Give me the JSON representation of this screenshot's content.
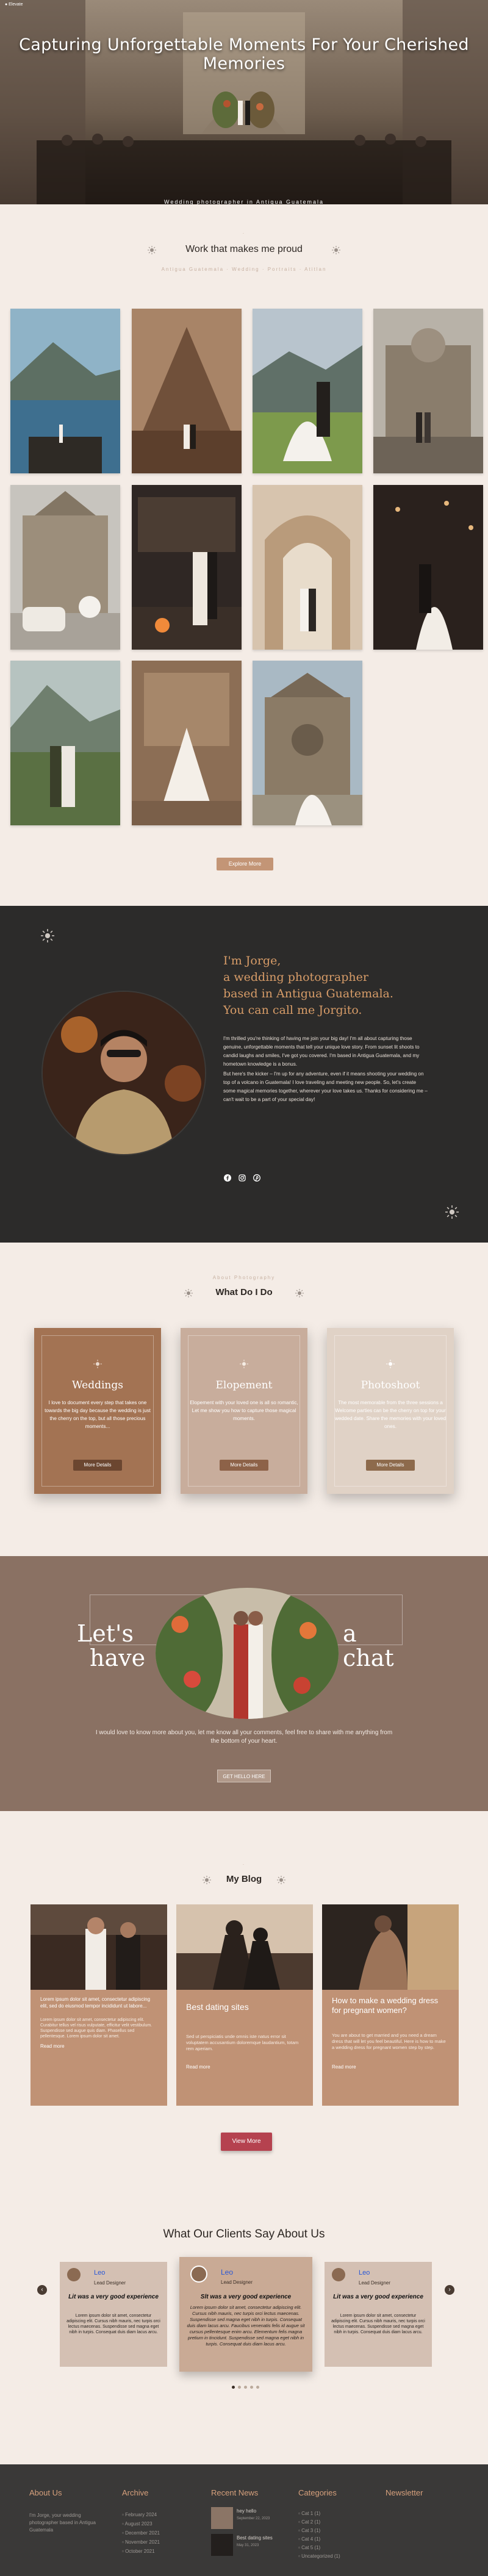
{
  "header": {
    "brand": "● Elevate"
  },
  "hero": {
    "title": "Capturing Unforgettable Moments For Your Cherished Memories",
    "subtitle": "Wedding photographer  in  Antigua Guatemala"
  },
  "work": {
    "title": "Work that makes me proud",
    "subtitle": "Antigua Guatemala · Wedding · Portraits · Atitlan",
    "explore_button": "Explore More"
  },
  "about": {
    "title_lines": [
      "I'm Jorge,",
      "a wedding photographer",
      "based in Antigua Guatemala.",
      "You can call me Jorgito."
    ],
    "paragraphs": [
      "I'm thrilled you're thinking of having me join your big day! I'm all about capturing those genuine, unforgettable moments that tell your unique love story. From sunset lit shoots to candid laughs and smiles, I've got you covered. I'm based in Antigua Guatemala, and my hometown knowledge is a bonus.",
      "But here's the kicker – I'm up for any adventure, even if it means shooting your wedding on top of a volcano in Guatemala! I love traveling and meeting new people. So, let's create some magical memories together, wherever your love takes us. Thanks for considering me – can't wait to be a part of your special day!"
    ],
    "social_icons": [
      "facebook-icon",
      "instagram-icon",
      "pinterest-icon"
    ]
  },
  "services": {
    "kicker": "About Photography",
    "title": "What Do I Do",
    "cards": [
      {
        "name": "Weddings",
        "text": "I love to document every step that takes one towards the big day because the wedding is just the cherry on the top, but all those precious moments...",
        "button": "More Details",
        "bg": "#a37353",
        "fg": "#ffffff",
        "btn_bg": "#6b4630"
      },
      {
        "name": "Elopement",
        "text": "Elopement with your loved one is all so romantic, Let me show you how to capture those magical moments.",
        "button": "More Details",
        "bg": "#c8ad9c",
        "fg": "#ffffff",
        "btn_bg": "#8d6248"
      },
      {
        "name": "Photoshoot",
        "text": "The most memorable from the three sessions a Welcome parties can be the cherry on top for your wedded date. Share the memories with your loved ones.",
        "button": "More Details",
        "bg": "#e0d2c6",
        "fg": "#ffffff",
        "btn_bg": "#8d6a4c"
      }
    ]
  },
  "chat": {
    "left_word1": "Let's",
    "left_word2": "have",
    "right_word": "a chat",
    "text": "I would love to know more about you, let me know all your comments, feel free to share with me anything from the bottom of your heart.",
    "button": "GET HELLO HERE"
  },
  "blog": {
    "title": "My Blog",
    "posts": [
      {
        "title": "",
        "excerpt": "Lorem ipsum dolor sit amet, consectetur adipiscing elit, sed do eiusmod tempor incididunt ut labore...",
        "text": "Lorem ipsum dolor sit amet, consectetur adipiscing elit. Curabitur tellus vel risus vulputate, efficitur velit vestibulum. Suspendisse sed augue quis diam. Phasellus sed pellentesque. Lorem ipsum dolor sit amet.",
        "read_more": "Read more"
      },
      {
        "title": "Best dating sites",
        "excerpt": "",
        "text": "Sed ut perspiciatis unde omnis iste natus error sit voluptatem accusantium doloremque laudantium, totam rem aperiam.",
        "read_more": "Read more"
      },
      {
        "title": "How to make a wedding dress for pregnant women?",
        "excerpt": "",
        "text": "You are about to get married and you need a dream dress that will let you feel beautiful. Here is how to make a wedding dress for pregnant women step by step.",
        "read_more": "Read more"
      }
    ],
    "view_more": "View More"
  },
  "testimonials": {
    "title": "What Our Clients Say About Us",
    "items": [
      {
        "name": "Leo",
        "role": "Lead Designer",
        "headline": "Lit was a very good experience",
        "text": "Lorem ipsum dolor sit amet, consectetur adipiscing elit. Cursus nibh mauris, nec turpis orci lectus maecenas. Suspendisse sed magna eget nibh in turpis. Consequat duis diam lacus arcu."
      },
      {
        "name": "Leo",
        "role": "Lead Designer",
        "headline": "Slt was a very good experience",
        "text": "Lorem ipsum dolor sit amet, consectetur adipiscing elit. Cursus nibh mauris, nec turpis orci lectus maecenas. Suspendisse sed magna eget nibh in turpis. Consequat duis diam lacus arcu. Faucibus venenatis felis id augue sit cursus pellentesque enim arcu. Elementum felis magna pretium in tincidunt. Suspendisse sed magna eget nibh in turpis. Consequat duis diam lacus arcu."
      },
      {
        "name": "Leo",
        "role": "Lead Designer",
        "headline": "Lit was a very good experience",
        "text": "Lorem ipsum dolor sit amet, consectetur adipiscing elit. Cursus nibh mauris, nec turpis orci lectus maecenas. Suspendisse sed magna eget nibh in turpis. Consequat duis diam lacus arcu."
      }
    ]
  },
  "footer": {
    "about_title": "About Us",
    "about_text": "I'm Jorge, your wedding photographer based in Antigua Guatemala",
    "archive_title": "Archive",
    "archive": [
      "February 2024",
      "August 2023",
      "December 2021",
      "November 2021",
      "October 2021"
    ],
    "news_title": "Recent News",
    "news": [
      {
        "title": "hey hello",
        "date": "September 22, 2023"
      },
      {
        "title": "Best dating sites",
        "date": "May 31, 2023"
      }
    ],
    "cat_title": "Categories",
    "categories": [
      "Cat 1 (1)",
      "Cat 2 (1)",
      "Cat 3 (1)",
      "Cat 4 (1)",
      "Cat 5 (1)",
      "Uncategorized (1)"
    ],
    "newsletter_title": "Newsletter"
  },
  "colors": {
    "accent": "#c39576",
    "dark": "#2c2b2a",
    "chat_bg": "#8a7163",
    "blog_button": "#b5424f",
    "testimonial_name": "#2957d6"
  }
}
